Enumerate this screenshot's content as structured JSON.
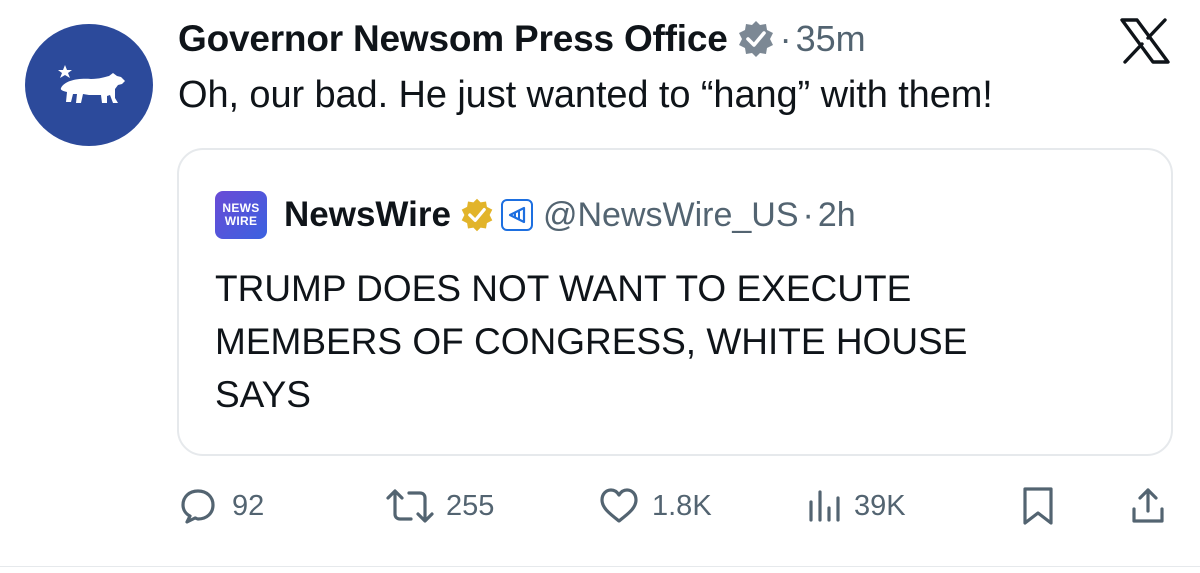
{
  "author": {
    "display_name": "Governor Newsom Press Office",
    "separator": "·",
    "time": "35m",
    "avatar_icon": "california-bear-icon",
    "verified_icon": "verified-badge-icon",
    "avatar_color": "#2c4a9b"
  },
  "tweet": {
    "text": "Oh, our bad. He just wanted to “hang” with them!"
  },
  "platform": {
    "logo_icon": "x-logo-icon"
  },
  "quote": {
    "logo_lines": [
      "NEWS",
      "WIRE"
    ],
    "display_name": "NewsWire",
    "handle": "@NewsWire_US",
    "separator": "·",
    "time": "2h",
    "badge_icon": "gold-verified-badge-icon",
    "affiliate_icon": "affiliate-badge-icon",
    "text": "TRUMP DOES NOT WANT TO EXECUTE\nMEMBERS OF CONGRESS, WHITE HOUSE\nSAYS"
  },
  "actions": {
    "replies": "92",
    "reposts": "255",
    "likes": "1.8K",
    "views": "39K"
  },
  "colors": {
    "text": "#0f1419",
    "muted": "#536471",
    "border": "#e6e9ec",
    "gold": "#e2b42a",
    "affiliate_blue": "#1d6fe0"
  }
}
